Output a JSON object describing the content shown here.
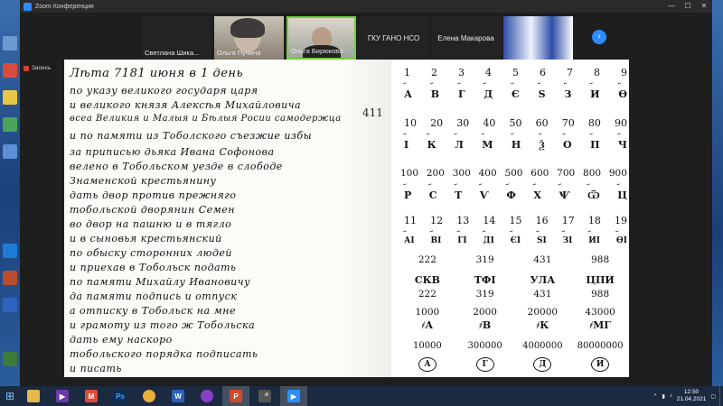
{
  "window": {
    "title": "Zoom Конференция"
  },
  "participants": [
    {
      "name": "Светлана  Шика...",
      "video": false
    },
    {
      "name": "Ольга Пучина",
      "video": true
    },
    {
      "name": "Ольга Бирюкова",
      "video": true,
      "active": true
    },
    {
      "name": "ГКУ ГАНО НСО",
      "video": false
    },
    {
      "name": "Елена Макарова",
      "video": false
    },
    {
      "name": "",
      "video": true
    }
  ],
  "share": {
    "label": "Запись"
  },
  "manuscript": {
    "lines": [
      "Лѣта 7181 июня в 1 день",
      "по указу великого государя царя",
      "и великого князя Алексѣя Михайловича",
      "всеа Великия и Малыя и Бѣлыя Росии самодержца",
      "и по памяти из Тоболского съезжие избы",
      "за приписью дьяка Ивана Софонова",
      "велено в Тобольском уезде в слободе",
      "Знаменской крестьянину",
      "дать двор против прежняго",
      "тобольской дворянин Семен",
      "во двор на пашню и в тягло",
      "и в сыновья крестьянский",
      "по обыску сторонних людей",
      "и приехав в Тобольск подать",
      "по памяти Михайлу Ивановичу",
      "да памяти подпись и отпуск",
      "а отписку в Тобольск на мне",
      "и грамоту из того ж Тобольска",
      "дать ему наскоро",
      "тобольского порядка подписать",
      "и писать"
    ],
    "margin_note": "411"
  },
  "numerals": {
    "row1_numbers": [
      "1",
      "2",
      "3",
      "4",
      "5",
      "6",
      "7",
      "8",
      "9"
    ],
    "row1_letters": [
      "А",
      "В",
      "Г",
      "Д",
      "Є",
      "Ѕ",
      "З",
      "И",
      "Ѳ"
    ],
    "row2_numbers": [
      "10",
      "20",
      "30",
      "40",
      "50",
      "60",
      "70",
      "80",
      "90"
    ],
    "row2_letters": [
      "І",
      "К",
      "Л",
      "М",
      "Н",
      "Ѯ",
      "О",
      "П",
      "Ч"
    ],
    "row3_numbers": [
      "100",
      "200",
      "300",
      "400",
      "500",
      "600",
      "700",
      "800",
      "900"
    ],
    "row3_letters": [
      "Р",
      "С",
      "Т",
      "Ѵ",
      "Ф",
      "Х",
      "Ѱ",
      "Ѿ",
      "Ц"
    ],
    "row4_numbers": [
      "11",
      "12",
      "13",
      "14",
      "15",
      "16",
      "17",
      "18",
      "19"
    ],
    "row4_letters": [
      "АІ",
      "ВІ",
      "ГІ",
      "ДІ",
      "ЄІ",
      "ЅІ",
      "ЗІ",
      "ИІ",
      "ѲІ"
    ],
    "composite_values": [
      "222",
      "319",
      "431",
      "988"
    ],
    "composite_letters": [
      "СКВ",
      "ТФІ",
      "УЛА",
      "ЦПИ"
    ],
    "composite_values2": [
      "222",
      "319",
      "431",
      "988"
    ],
    "thousands_values": [
      "1000",
      "2000",
      "20000",
      "43000"
    ],
    "thousands_letters": [
      "҂А",
      "҂В",
      "҂К",
      "҂МГ"
    ],
    "large_values": [
      "10000",
      "300000",
      "4000000",
      "80000000"
    ],
    "large_letters": [
      "А",
      "Г",
      "Д",
      "И"
    ]
  },
  "taskbar": {
    "apps": [
      "explorer",
      "media",
      "gmail",
      "photoshop",
      "chrome",
      "word",
      "browser",
      "powerpoint",
      "microphone",
      "zoom"
    ],
    "clock_time": "12:50",
    "clock_date": "21.04.2021"
  }
}
